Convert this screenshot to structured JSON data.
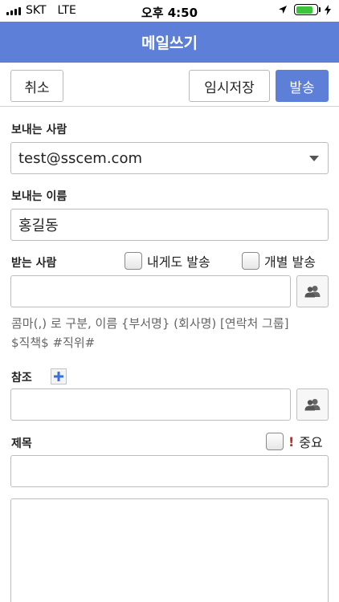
{
  "status_bar": {
    "carrier": "SKT",
    "network": "LTE",
    "time": "오후 4:50",
    "battery_level": 0.8,
    "battery_color": "#3cc43c"
  },
  "header": {
    "title": "메일쓰기",
    "background_color": "#5d7fd8"
  },
  "toolbar": {
    "cancel_label": "취소",
    "draft_label": "임시저장",
    "send_label": "발송"
  },
  "form": {
    "sender": {
      "label": "보내는 사람",
      "value": "test@sscem.com"
    },
    "sender_name": {
      "label": "보내는 이름",
      "value": "홍길동"
    },
    "recipients": {
      "label": "받는 사람",
      "send_to_me_label": "내게도 발송",
      "individual_send_label": "개별 발송",
      "value": "",
      "help_line1": "콤마(,) 로 구분, 이름 {부서명} (회사명) [연락처 그룹]",
      "help_line2": "$직책$ #직위#"
    },
    "cc": {
      "label": "참조",
      "value": ""
    },
    "subject": {
      "label": "제목",
      "important_mark": "!",
      "important_label": "중요",
      "value": ""
    },
    "body": {
      "value": ""
    }
  },
  "icons": {
    "address_book": "people-icon",
    "add_cc": "plus-icon",
    "dropdown": "caret-down-icon"
  }
}
